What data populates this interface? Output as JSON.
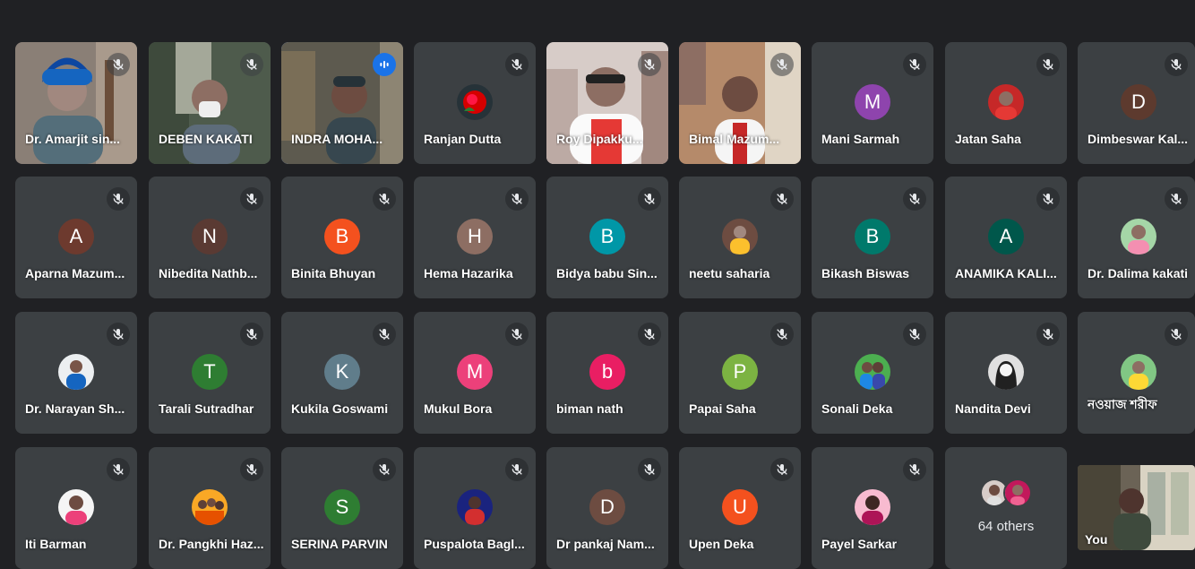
{
  "meeting": {
    "others_label": "64 others",
    "self_label": "You"
  },
  "participants": [
    {
      "name": "Dr. Amarjit sin...",
      "type": "video",
      "muted": true
    },
    {
      "name": "DEBEN KAKATI",
      "type": "video",
      "muted": true
    },
    {
      "name": "INDRA MOHA...",
      "type": "video",
      "speaking": true
    },
    {
      "name": "Ranjan Dutta",
      "type": "photo",
      "photo": "rose",
      "muted": true
    },
    {
      "name": "Roy Dipakku...",
      "type": "video",
      "muted": true
    },
    {
      "name": "Bimal Mazum...",
      "type": "video",
      "muted": true
    },
    {
      "name": "Mani Sarmah",
      "type": "initial",
      "initial": "M",
      "color": "#8e44ad",
      "muted": true
    },
    {
      "name": "Jatan Saha",
      "type": "photo",
      "photo": "person-red",
      "muted": true
    },
    {
      "name": "Dimbeswar Kal...",
      "type": "initial",
      "initial": "D",
      "color": "#5d3a2e",
      "muted": true
    },
    {
      "name": "Aparna Mazum...",
      "type": "initial",
      "initial": "A",
      "color": "#6d3a2e",
      "muted": true
    },
    {
      "name": "Nibedita Nathb...",
      "type": "initial",
      "initial": "N",
      "color": "#5a3a33",
      "muted": true
    },
    {
      "name": "Binita Bhuyan",
      "type": "initial",
      "initial": "B",
      "color": "#f4511e",
      "muted": true
    },
    {
      "name": "Hema Hazarika",
      "type": "initial",
      "initial": "H",
      "color": "#8d6e63",
      "muted": true
    },
    {
      "name": "Bidya babu Sin...",
      "type": "initial",
      "initial": "B",
      "color": "#0097a7",
      "muted": true
    },
    {
      "name": "neetu saharia",
      "type": "photo",
      "photo": "person-yellow",
      "muted": true
    },
    {
      "name": "Bikash Biswas",
      "type": "initial",
      "initial": "B",
      "color": "#00796b",
      "muted": true
    },
    {
      "name": "ANAMIKA KALI...",
      "type": "initial",
      "initial": "A",
      "color": "#00574b",
      "muted": true
    },
    {
      "name": "Dr. Dalima kakati",
      "type": "photo",
      "photo": "person-pink",
      "muted": true
    },
    {
      "name": "Dr. Narayan Sh...",
      "type": "photo",
      "photo": "person-blue",
      "muted": true
    },
    {
      "name": "Tarali Sutradhar",
      "type": "initial",
      "initial": "T",
      "color": "#2e7d32",
      "muted": true
    },
    {
      "name": "Kukila Goswami",
      "type": "initial",
      "initial": "K",
      "color": "#607d8b",
      "muted": true
    },
    {
      "name": "Mukul Bora",
      "type": "initial",
      "initial": "M",
      "color": "#ec407a",
      "muted": true
    },
    {
      "name": "biman nath",
      "type": "initial",
      "initial": "b",
      "color": "#e91e63",
      "muted": true
    },
    {
      "name": "Papai Saha",
      "type": "initial",
      "initial": "P",
      "color": "#7cb342",
      "muted": true
    },
    {
      "name": "Sonali Deka",
      "type": "photo",
      "photo": "person-couple",
      "muted": true
    },
    {
      "name": "Nandita Devi",
      "type": "photo",
      "photo": "person-bw",
      "muted": true
    },
    {
      "name": "নওয়াজ শরীফ",
      "type": "photo",
      "photo": "person-green",
      "muted": true
    },
    {
      "name": "Iti Barman",
      "type": "photo",
      "photo": "person-pink2",
      "muted": true
    },
    {
      "name": "Dr. Pangkhi Haz...",
      "type": "photo",
      "photo": "person-group",
      "muted": true
    },
    {
      "name": "SERINA PARVIN",
      "type": "initial",
      "initial": "S",
      "color": "#2e7d32",
      "muted": true
    },
    {
      "name": "Puspalota Bagl...",
      "type": "photo",
      "photo": "person-dark",
      "muted": true
    },
    {
      "name": "Dr pankaj Nam...",
      "type": "initial",
      "initial": "D",
      "color": "#6d4c41",
      "muted": true
    },
    {
      "name": "Upen Deka",
      "type": "initial",
      "initial": "U",
      "color": "#f4511e",
      "muted": true
    },
    {
      "name": "Payel Sarkar",
      "type": "photo",
      "photo": "person-pink3",
      "muted": true
    }
  ],
  "colors": {
    "background": "#202124",
    "tile": "#3c4043",
    "speaking_outline": "#8ab4f8",
    "speaking_badge": "#1a73e8"
  }
}
